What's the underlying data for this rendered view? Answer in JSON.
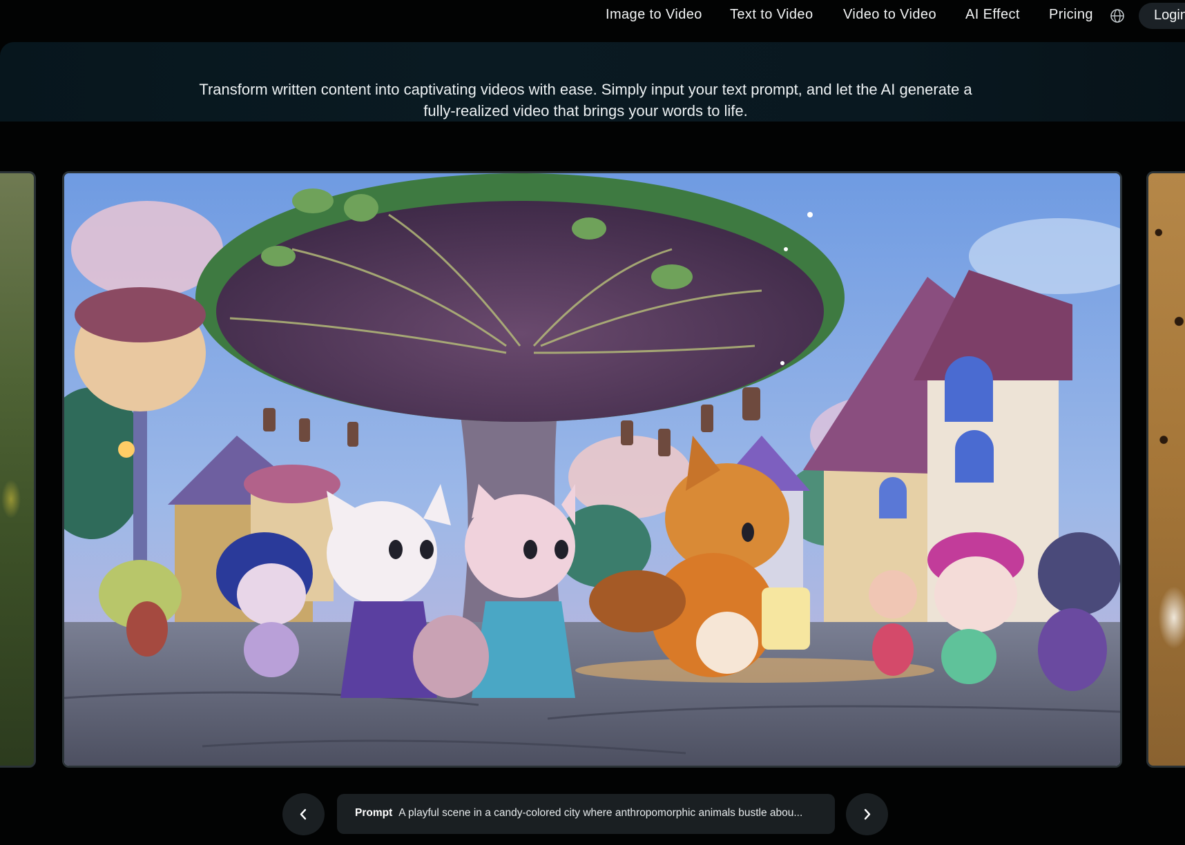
{
  "nav": {
    "items": [
      {
        "label": "Image to Video"
      },
      {
        "label": "Text to Video"
      },
      {
        "label": "Video to Video"
      },
      {
        "label": "AI Effect"
      },
      {
        "label": "Pricing"
      }
    ],
    "language_icon": "globe-icon",
    "login_label": "Login"
  },
  "hero": {
    "description": "Transform written content into captivating videos with ease. Simply input your text prompt, and let the AI generate a fully-realized video that brings your words to life."
  },
  "carousel": {
    "prev_icon": "chevron-left-icon",
    "next_icon": "chevron-right-icon",
    "prompt_label": "Prompt",
    "prompt_text": "A playful scene in a candy-colored city where anthropomorphic animals bustle abou..."
  },
  "colors": {
    "page_background": "#020303",
    "hero_band": "#0a1a22",
    "control_background": "#1a1f22"
  }
}
